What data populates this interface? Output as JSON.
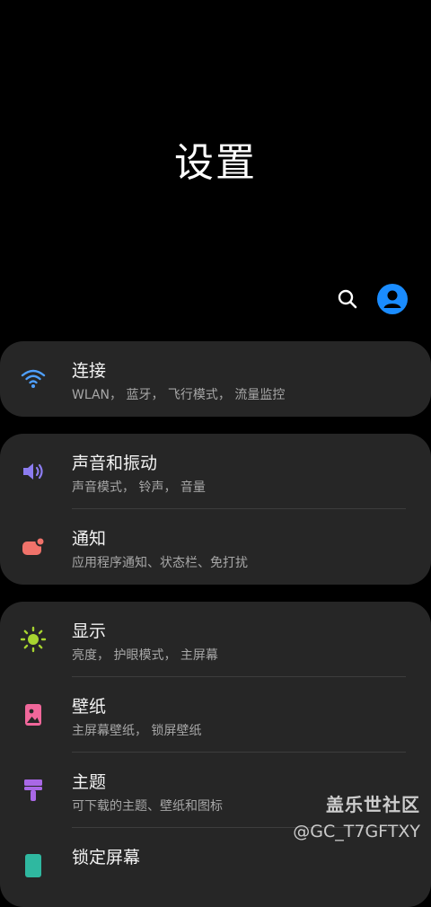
{
  "header": {
    "title": "设置",
    "search_icon": "search-icon",
    "account_icon": "account-icon",
    "accent_color": "#1a8cff"
  },
  "groups": [
    {
      "items": [
        {
          "title": "连接",
          "subtitle": "WLAN， 蓝牙， 飞行模式， 流量监控",
          "icon": "wifi-icon",
          "icon_color": "#4fa0ff"
        }
      ]
    },
    {
      "items": [
        {
          "title": "声音和振动",
          "subtitle": "声音模式， 铃声， 音量",
          "icon": "volume-icon",
          "icon_color": "#8c7cf0"
        },
        {
          "title": "通知",
          "subtitle": "应用程序通知、状态栏、免打扰",
          "icon": "notification-icon",
          "icon_color": "#f0726a"
        }
      ]
    },
    {
      "items": [
        {
          "title": "显示",
          "subtitle": "亮度， 护眼模式， 主屏幕",
          "icon": "brightness-icon",
          "icon_color": "#a7d430"
        },
        {
          "title": "壁纸",
          "subtitle": "主屏幕壁纸， 锁屏壁纸",
          "icon": "wallpaper-icon",
          "icon_color": "#f0679a"
        },
        {
          "title": "主题",
          "subtitle": "可下载的主题、壁纸和图标",
          "icon": "theme-brush-icon",
          "icon_color": "#a968e6"
        },
        {
          "title": "锁定屏幕",
          "subtitle": "",
          "icon": "lock-screen-icon",
          "icon_color": "#2fb8a0"
        }
      ]
    }
  ],
  "watermark": {
    "main": "盖乐世社区",
    "sub": "@GC_T7GFTXY"
  }
}
